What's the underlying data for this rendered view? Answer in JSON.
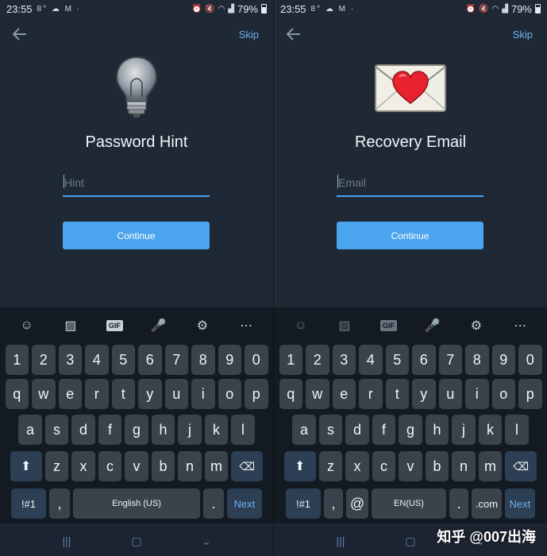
{
  "status": {
    "time": "23:55",
    "battery": "79%"
  },
  "screens": [
    {
      "skip": "Skip",
      "title": "Password Hint",
      "placeholder": "Hint",
      "button": "Continue",
      "icon": "lightbulb-icon",
      "keyboard": {
        "numbers": [
          "1",
          "2",
          "3",
          "4",
          "5",
          "6",
          "7",
          "8",
          "9",
          "0"
        ],
        "row1": [
          "q",
          "w",
          "e",
          "r",
          "t",
          "y",
          "u",
          "i",
          "o",
          "p"
        ],
        "row2": [
          "a",
          "s",
          "d",
          "f",
          "g",
          "h",
          "j",
          "k",
          "l"
        ],
        "row3": [
          "z",
          "x",
          "c",
          "v",
          "b",
          "n",
          "m"
        ],
        "symbols": "!#1",
        "comma": ",",
        "space": "English (US)",
        "period": ".",
        "next": "Next",
        "toolbar_gif": "GIF"
      }
    },
    {
      "skip": "Skip",
      "title": "Recovery Email",
      "placeholder": "Email",
      "button": "Continue",
      "icon": "love-letter-icon",
      "keyboard": {
        "numbers": [
          "1",
          "2",
          "3",
          "4",
          "5",
          "6",
          "7",
          "8",
          "9",
          "0"
        ],
        "row1": [
          "q",
          "w",
          "e",
          "r",
          "t",
          "y",
          "u",
          "i",
          "o",
          "p"
        ],
        "row2": [
          "a",
          "s",
          "d",
          "f",
          "g",
          "h",
          "j",
          "k",
          "l"
        ],
        "row3": [
          "z",
          "x",
          "c",
          "v",
          "b",
          "n",
          "m"
        ],
        "symbols": "!#1",
        "comma": ",",
        "at": "@",
        "space": "EN(US)",
        "period": ".",
        "dotcom": ".com",
        "next": "Next",
        "toolbar_gif": "GIF"
      }
    }
  ],
  "watermark": "知乎 @007出海",
  "colors": {
    "background": "#1f2936",
    "accent": "#4aa4ee",
    "keyboard": "#131a22",
    "key": "#3a424c"
  }
}
